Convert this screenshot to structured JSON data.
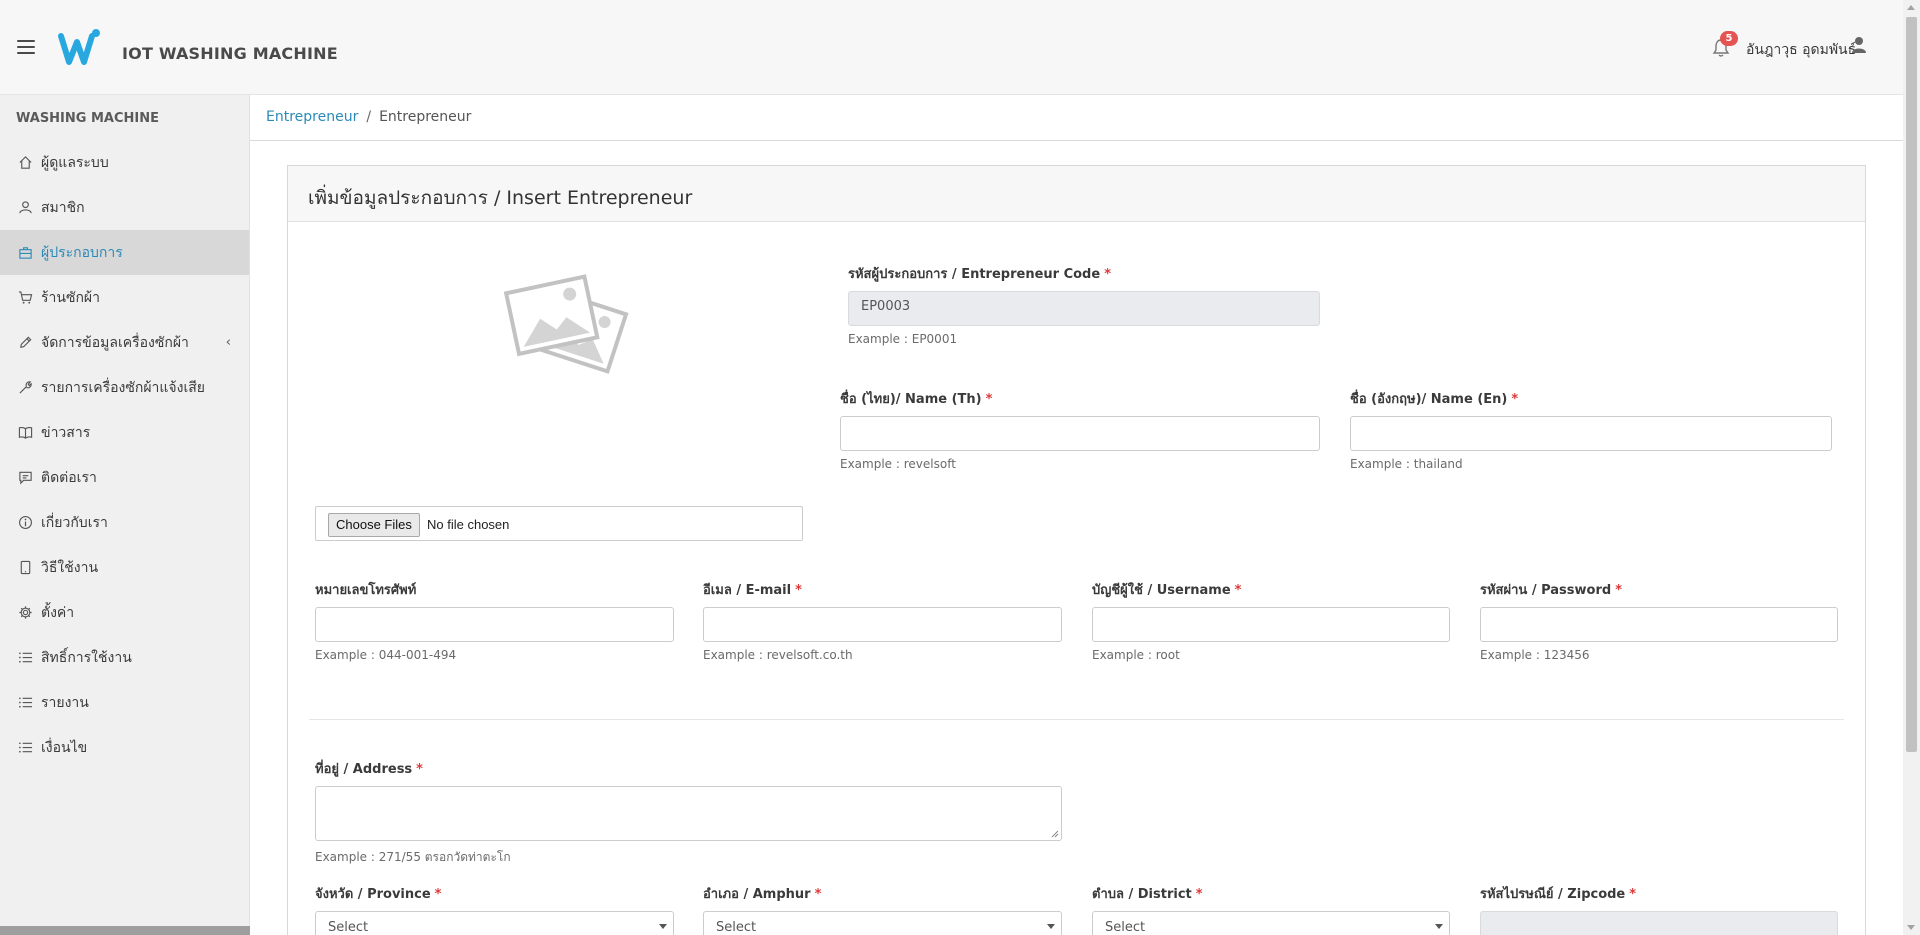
{
  "header": {
    "app_title": "IOT WASHING MACHINE",
    "notification_count": "5",
    "user_name": "อันฎาวุธ อุดมพันธ์"
  },
  "sidebar": {
    "section_title": "WASHING MACHINE",
    "items": [
      {
        "label": "ผู้ดูแลระบบ",
        "icon": "home-icon"
      },
      {
        "label": "สมาชิก",
        "icon": "user-icon"
      },
      {
        "label": "ผู้ประกอบการ",
        "icon": "briefcase-icon",
        "active": true
      },
      {
        "label": "ร้านซักผ้า",
        "icon": "cart-icon"
      },
      {
        "label": "จัดการข้อมูลเครื่องซักผ้า",
        "icon": "pencil-icon",
        "chevron": "‹"
      },
      {
        "label": "รายการเครื่องซักผ้าแจ้งเสีย",
        "icon": "wrench-icon"
      },
      {
        "label": "ข่าวสาร",
        "icon": "book-icon"
      },
      {
        "label": "ติดต่อเรา",
        "icon": "chat-icon"
      },
      {
        "label": "เกี่ยวกับเรา",
        "icon": "info-icon"
      },
      {
        "label": "วิธีใช้งาน",
        "icon": "tablet-icon"
      },
      {
        "label": "ตั้งค่า",
        "icon": "gear-icon"
      },
      {
        "label": "สิทธิ์การใช้งาน",
        "icon": "list-icon"
      },
      {
        "label": "รายงาน",
        "icon": "list-icon"
      },
      {
        "label": "เงื่อนไข",
        "icon": "list-icon"
      }
    ]
  },
  "breadcrumb": {
    "link": "Entrepreneur",
    "separator": "/",
    "current": "Entrepreneur"
  },
  "form": {
    "title": "เพิ่มข้อมูลประกอบการ / Insert Entrepreneur",
    "required_mark": "*",
    "code": {
      "label": "รหัสผู้ประกอบการ / Entrepreneur Code",
      "value": "EP0003",
      "hint": "Example : EP0001"
    },
    "name_th": {
      "label": "ชื่อ (ไทย)/ Name (Th)",
      "value": "",
      "hint": "Example : revelsoft"
    },
    "name_en": {
      "label": "ชื่อ (อังกฤษ)/ Name (En)",
      "value": "",
      "hint": "Example : thailand"
    },
    "file": {
      "button": "Choose Files",
      "status": "No file chosen"
    },
    "phone": {
      "label": "หมายเลขโทรศัพท์",
      "value": "",
      "hint": "Example : 044-001-494"
    },
    "email": {
      "label": "อีเมล / E-mail",
      "value": "",
      "hint": "Example : revelsoft.co.th"
    },
    "username": {
      "label": "บัญชีผู้ใช้ / Username",
      "value": "",
      "hint": "Example : root"
    },
    "password": {
      "label": "รหัสผ่าน / Password",
      "value": "",
      "hint": "Example : 123456"
    },
    "address": {
      "label": "ที่อยู่ / Address",
      "value": "",
      "hint": "Example : 271/55 ตรอกวัดท่าตะโก"
    },
    "province": {
      "label": "จังหวัด / Province",
      "value": "Select"
    },
    "amphur": {
      "label": "อำเภอ / Amphur",
      "value": "Select"
    },
    "district": {
      "label": "ตำบล / District",
      "value": "Select"
    },
    "zipcode": {
      "label": "รหัสไปรษณีย์ / Zipcode",
      "value": ""
    }
  },
  "colors": {
    "accent": "#2a8ab8",
    "logo": "#29a8e0",
    "required": "#e03838",
    "badge": "#e55353"
  }
}
